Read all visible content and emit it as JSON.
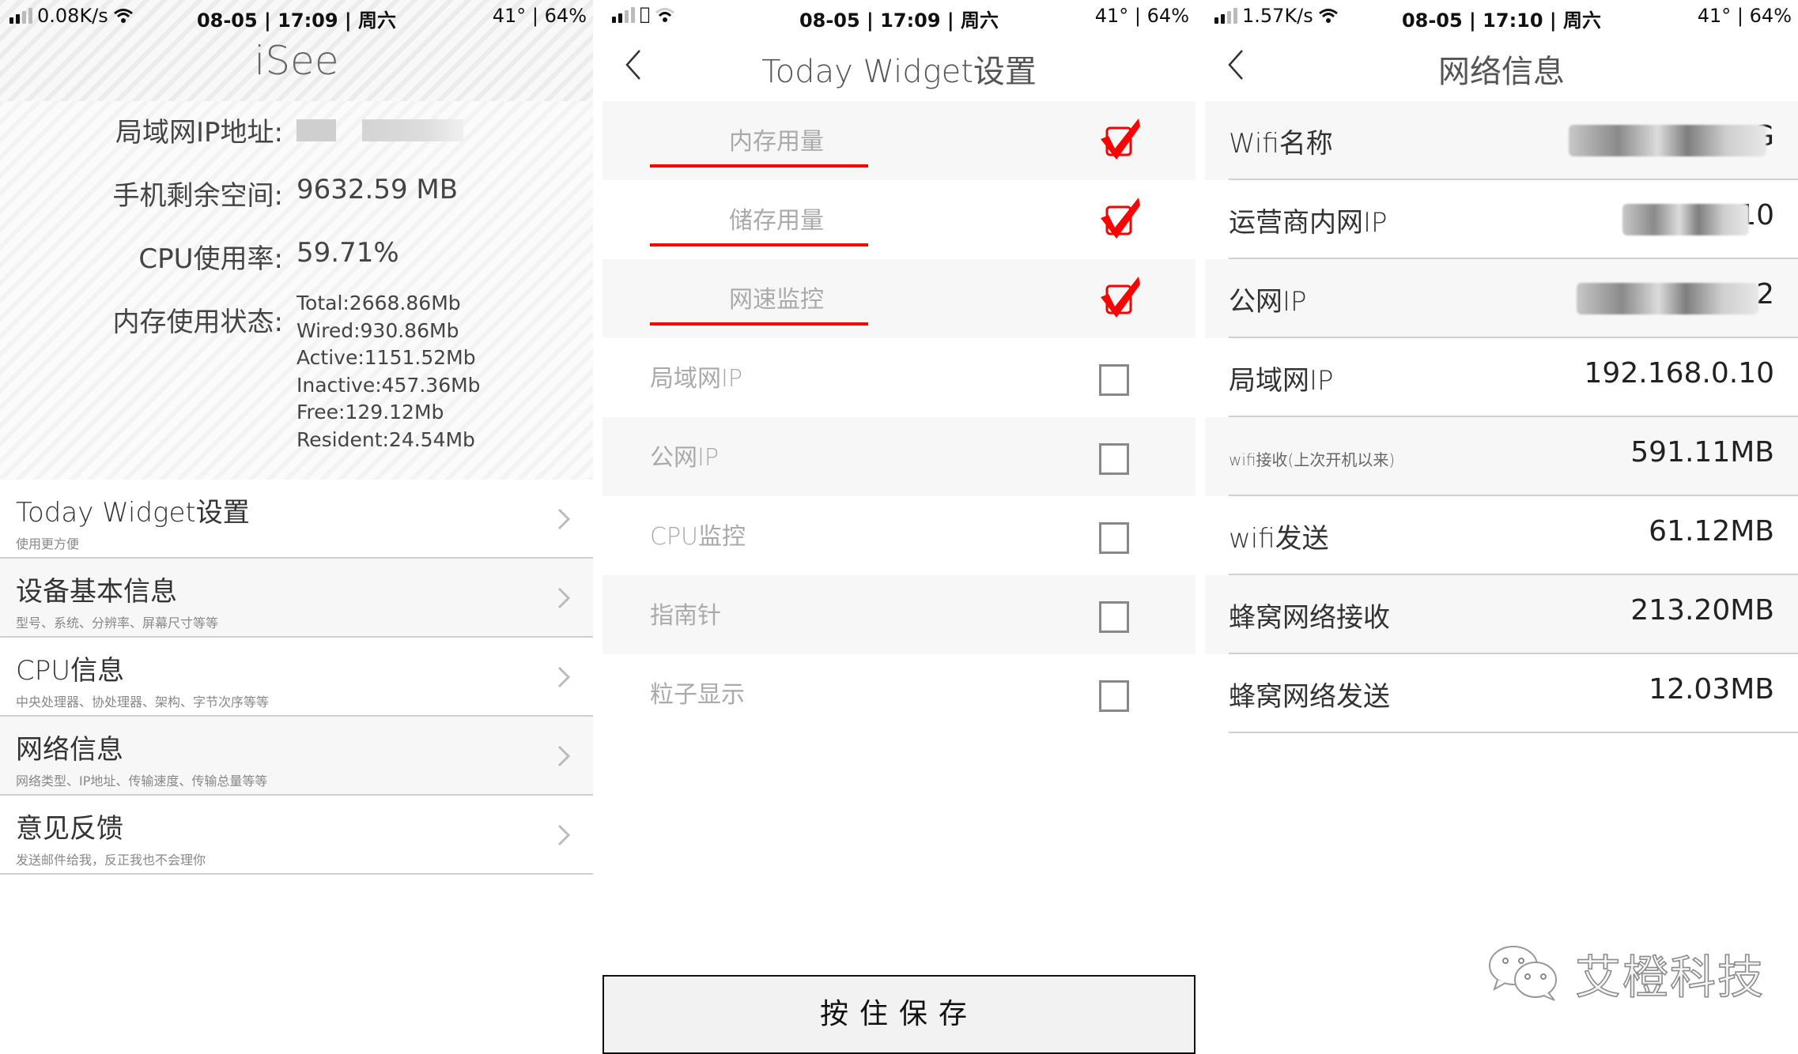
{
  "left": {
    "status": {
      "speed": "0.08K/s",
      "datetime": "08-05 | 17:09 | 周六",
      "temp_battery": "41° | 64%"
    },
    "app_title": "iSee",
    "info": [
      {
        "label": "局域网IP地址:",
        "value": ""
      },
      {
        "label": "手机剩余空间:",
        "value": "9632.59 MB"
      },
      {
        "label": "CPU使用率:",
        "value": "59.71%"
      },
      {
        "label": "内存使用状态:",
        "value": ""
      }
    ],
    "memory": [
      "Total:2668.86Mb",
      "Wired:930.86Mb",
      "Active:1151.52Mb",
      "Inactive:457.36Mb",
      "Free:129.12Mb",
      "Resident:24.54Mb"
    ],
    "menu": [
      {
        "title": "Today Widget设置",
        "subtitle": "使用更方便"
      },
      {
        "title": "设备基本信息",
        "subtitle": "型号、系统、分辨率、屏幕尺寸等等"
      },
      {
        "title": "CPU信息",
        "subtitle": "中央处理器、协处理器、架构、字节次序等等"
      },
      {
        "title": "网络信息",
        "subtitle": "网络类型、IP地址、传输速度、传输总量等等"
      },
      {
        "title": "意见反馈",
        "subtitle": "发送邮件给我，反正我也不会理你"
      }
    ]
  },
  "middle": {
    "status": {
      "datetime": "08-05 | 17:09 | 周六",
      "temp_battery": "41° | 64%"
    },
    "title": "Today Widget设置",
    "options": [
      {
        "label": "内存用量",
        "checked": true
      },
      {
        "label": "储存用量",
        "checked": true
      },
      {
        "label": "网速监控",
        "checked": true
      },
      {
        "label": "局域网IP",
        "checked": false
      },
      {
        "label": "公网IP",
        "checked": false
      },
      {
        "label": "CPU监控",
        "checked": false
      },
      {
        "label": "指南针",
        "checked": false
      },
      {
        "label": "粒子显示",
        "checked": false
      }
    ],
    "save_label": "按住保存",
    "accent_color": "#ff0000"
  },
  "right": {
    "status": {
      "speed": "1.57K/s",
      "datetime": "08-05 | 17:10 | 周六",
      "temp_battery": "41° | 64%"
    },
    "title": "网络信息",
    "rows": [
      {
        "label": "Wifi名称",
        "value": "G"
      },
      {
        "label": "运营商内网IP",
        "value": "10"
      },
      {
        "label": "公网IP",
        "value": "2"
      },
      {
        "label": "局域网IP",
        "value": "192.168.0.10"
      },
      {
        "label": "wifi接收(上次开机以来)",
        "value": "591.11MB"
      },
      {
        "label": "wifi发送",
        "value": "61.12MB"
      },
      {
        "label": "蜂窝网络接收",
        "value": "213.20MB"
      },
      {
        "label": "蜂窝网络发送",
        "value": "12.03MB"
      }
    ]
  },
  "watermark": {
    "text": "艾橙科技",
    "icon": "wechat-icon"
  }
}
